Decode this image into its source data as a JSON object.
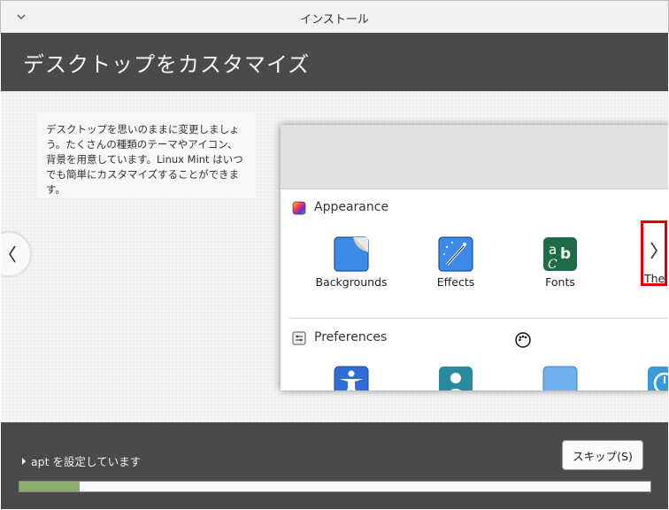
{
  "window": {
    "title": "インストール"
  },
  "header": {
    "title": "デスクトップをカスタマイズ"
  },
  "slide": {
    "description": "デスクトップを思いのままに変更しましょう。たくさんの種類のテーマやアイコン、背景を用意しています。Linux Mint はいつでも簡単にカスタマイズすることができます。",
    "sections": [
      {
        "title": "Appearance",
        "items": [
          {
            "label": "Backgrounds",
            "icon": "backgrounds-icon"
          },
          {
            "label": "Effects",
            "icon": "effects-icon"
          },
          {
            "label": "Fonts",
            "icon": "fonts-icon"
          },
          {
            "label": "The",
            "icon": "themes-icon"
          }
        ]
      },
      {
        "title": "Preferences",
        "items": [
          {
            "icon": "accessibility-icon"
          },
          {
            "icon": "account-details-icon"
          },
          {
            "icon": "folder-icon"
          },
          {
            "icon": "date-time-icon"
          }
        ]
      }
    ]
  },
  "footer": {
    "status": "apt を設定しています",
    "skip_label": "スキップ(S)",
    "progress_fraction": 0.095
  },
  "colors": {
    "header_bg": "#4a4a4a",
    "progress_fill": "#8aae6f",
    "highlight": "#e00000"
  }
}
